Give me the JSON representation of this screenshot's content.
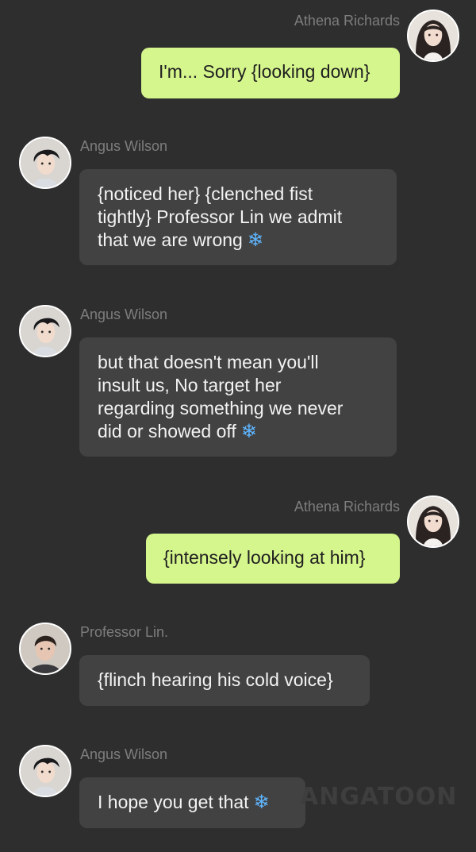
{
  "messages": [
    {
      "side": "right",
      "sender": "Athena Richards",
      "avatar": "female-character-avatar",
      "text": "I'm... Sorry {looking down}",
      "has_snowflake": false
    },
    {
      "side": "left",
      "sender": "Angus Wilson",
      "avatar": "male-character-avatar",
      "text_lines": [
        "{noticed her} {clenched fist",
        "tightly} Professor Lin we admit",
        "that we are wrong"
      ],
      "has_snowflake": true
    },
    {
      "side": "left",
      "sender": "Angus Wilson",
      "avatar": "male-character-avatar",
      "text_lines": [
        "but that doesn't mean you'll",
        "insult us, No target her",
        "regarding something we never",
        "did or showed off"
      ],
      "has_snowflake": true
    },
    {
      "side": "right",
      "sender": "Athena Richards",
      "avatar": "female-character-avatar",
      "text": "{intensely looking at him}",
      "has_snowflake": false
    },
    {
      "side": "left",
      "sender": "Professor Lin.",
      "avatar": "professor-character-avatar",
      "text": "{flinch hearing his cold voice}",
      "has_snowflake": false
    },
    {
      "side": "left",
      "sender": "Angus Wilson",
      "avatar": "male-character-avatar",
      "text": "I hope you get that",
      "has_snowflake": true
    }
  ],
  "snowflake": "❄",
  "watermark": "ANGATOON",
  "colors": {
    "background": "#2e2e2e",
    "right_bubble": "#d5f58d",
    "left_bubble": "#424242",
    "name_text": "#7d7d7d",
    "snowflake": "#5fb6ff"
  }
}
